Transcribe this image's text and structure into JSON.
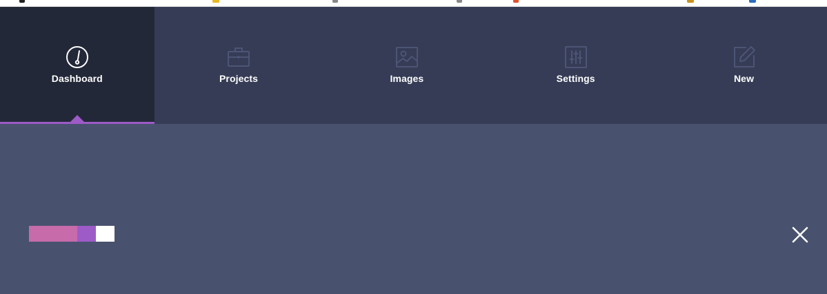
{
  "nav": {
    "items": [
      {
        "label": "Dashboard",
        "icon": "gauge-icon",
        "active": true
      },
      {
        "label": "Projects",
        "icon": "briefcase-icon",
        "active": false
      },
      {
        "label": "Images",
        "icon": "image-icon",
        "active": false
      },
      {
        "label": "Settings",
        "icon": "sliders-icon",
        "active": false
      },
      {
        "label": "New",
        "icon": "edit-icon",
        "active": false
      }
    ]
  },
  "theme": {
    "nav_background": "#363c56",
    "active_background": "#232838",
    "accent": "#9d5bc7",
    "panel_background": "#48526f",
    "icon_inactive": "#4c5575"
  },
  "swatches": [
    {
      "color": "#c76bab",
      "name": "pink"
    },
    {
      "color": "#9d5bc7",
      "name": "purple"
    },
    {
      "color": "#ffffff",
      "name": "white"
    }
  ],
  "close": {
    "icon": "close-icon"
  }
}
